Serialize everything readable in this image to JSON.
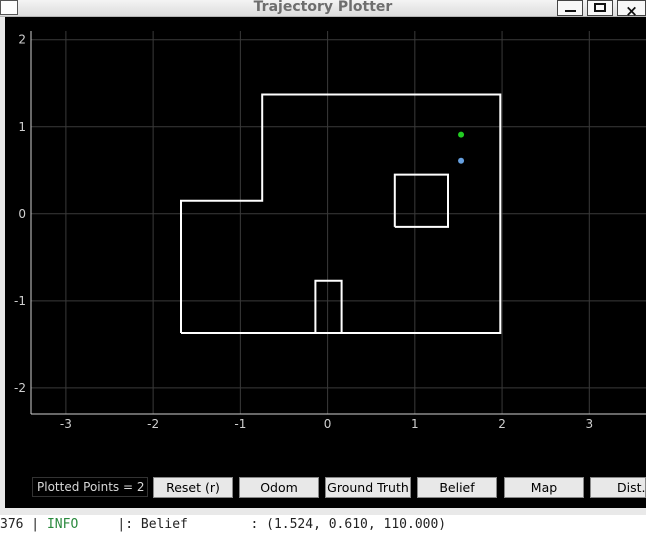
{
  "window": {
    "title": "Trajectory Plotter",
    "controls": {
      "minimize": "minimize-icon",
      "maximize": "maximize-icon",
      "close": "×"
    }
  },
  "plot": {
    "background": "#000000",
    "grid": true,
    "outline_color": "#ffffff",
    "xlim": [
      -3.4,
      3.65
    ],
    "ylim": [
      -2.3,
      2.1
    ],
    "x_ticks": [
      "-3",
      "-2",
      "-1",
      "0",
      "1",
      "2",
      "3"
    ],
    "y_ticks": [
      "2",
      "1",
      "0",
      "-1",
      "-2"
    ]
  },
  "chart_data": {
    "type": "scatter",
    "map_polygons": [
      [
        [
          -1.68,
          -1.37
        ],
        [
          1.98,
          -1.37
        ],
        [
          1.98,
          1.37
        ],
        [
          -0.75,
          1.37
        ],
        [
          -0.75,
          0.15
        ],
        [
          -1.68,
          0.15
        ],
        [
          -1.68,
          -1.37
        ]
      ],
      [
        [
          0.77,
          -0.15
        ],
        [
          1.38,
          -0.15
        ],
        [
          1.38,
          0.45
        ],
        [
          0.77,
          0.45
        ],
        [
          0.77,
          -0.15
        ]
      ],
      [
        [
          -0.14,
          -1.37
        ],
        [
          -0.14,
          -0.77
        ],
        [
          0.16,
          -0.77
        ],
        [
          0.16,
          -1.37
        ]
      ]
    ],
    "series": [
      {
        "color": "#22cc22",
        "values": [
          [
            1.53,
            0.91
          ]
        ]
      },
      {
        "color": "#66a0e0",
        "values": [
          [
            1.53,
            0.61
          ]
        ]
      }
    ]
  },
  "status": {
    "plotted_points": "Plotted Points = 2"
  },
  "buttons": [
    "Reset (r)",
    "Odom",
    "Ground Truth",
    "Belief",
    "Map",
    "Dist."
  ],
  "terminal": {
    "prefix": "376 | ",
    "level": "INFO",
    "message": "     |: Belief        : (1.524, 0.610, 110.000)"
  }
}
